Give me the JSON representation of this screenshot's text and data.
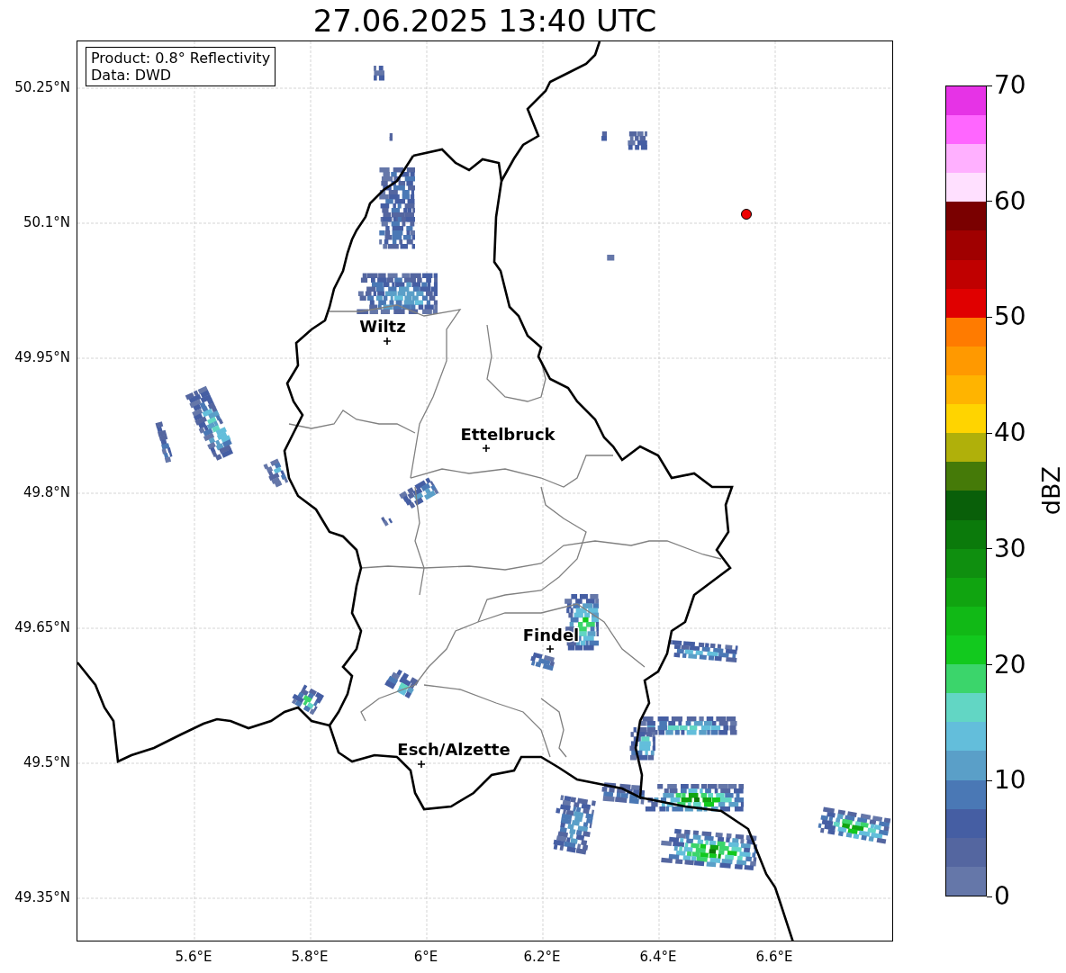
{
  "title": "27.06.2025 13:40 UTC",
  "info_box": [
    "Product: 0.8° Reflectivity",
    "Data: DWD"
  ],
  "lat_ticks": [
    "50.25°N",
    "50.1°N",
    "49.95°N",
    "49.8°N",
    "49.65°N",
    "49.5°N",
    "49.35°N"
  ],
  "lon_ticks": [
    "5.6°E",
    "5.8°E",
    "6°E",
    "6.2°E",
    "6.4°E",
    "6.6°E"
  ],
  "cities": [
    "Wiltz",
    "Ettelbruck",
    "Findel",
    "Esch/Alzette"
  ],
  "colorbar": {
    "label": "dBZ",
    "ticks": [
      "70",
      "60",
      "50",
      "40",
      "30",
      "20",
      "10",
      "0"
    ],
    "segments": [
      {
        "color": "#6577a9"
      },
      {
        "color": "#5466a0"
      },
      {
        "color": "#455ea3"
      },
      {
        "color": "#4a78b5"
      },
      {
        "color": "#5a9fc8"
      },
      {
        "color": "#63bedb"
      },
      {
        "color": "#62d6c4"
      },
      {
        "color": "#3bd56b"
      },
      {
        "color": "#12c91e"
      },
      {
        "color": "#11b916"
      },
      {
        "color": "#10a410"
      },
      {
        "color": "#0f8f0f"
      },
      {
        "color": "#0b7a0b"
      },
      {
        "color": "#095f09"
      },
      {
        "color": "#457a08"
      },
      {
        "color": "#b0b00a"
      },
      {
        "color": "#ffd400"
      },
      {
        "color": "#ffb400"
      },
      {
        "color": "#ff9900"
      },
      {
        "color": "#ff7b00"
      },
      {
        "color": "#e00000"
      },
      {
        "color": "#c00000"
      },
      {
        "color": "#a00000"
      },
      {
        "color": "#7a0000"
      },
      {
        "color": "#ffe0ff"
      },
      {
        "color": "#ffb0ff"
      },
      {
        "color": "#ff66ff"
      },
      {
        "color": "#e633e6"
      }
    ]
  }
}
